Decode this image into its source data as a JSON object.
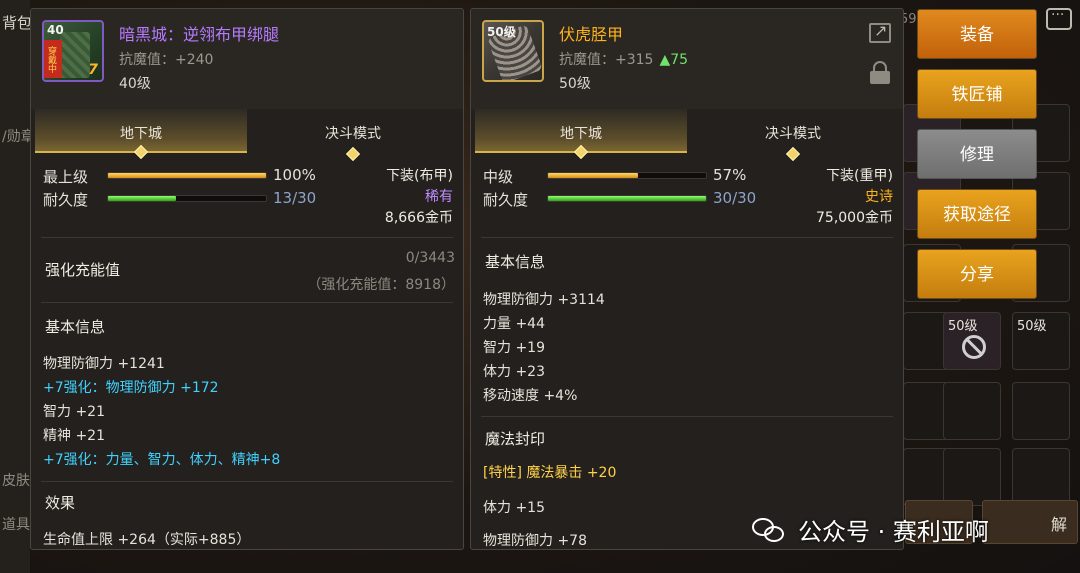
{
  "background": {
    "inventory_tab": "背包",
    "side_labels": [
      "/勋章",
      "皮肤",
      "道具"
    ],
    "top_stat": "59",
    "cells": [
      {
        "level": "50级",
        "banned": false
      },
      {
        "level": "50级",
        "banned": true
      },
      {
        "level": "50级",
        "banned": false
      }
    ],
    "bottom_btn_text": "解"
  },
  "item_left": {
    "name": "暗黑城：逆翎布甲绑腿",
    "resist_label": "抗魔值：",
    "resist_value": "+240",
    "level_req": "40级",
    "icon_level": "40",
    "icon_ribbon": "穿戴中",
    "icon_enhance": "7",
    "tabs": [
      "地下城",
      "决斗模式"
    ],
    "grade_label": "最上级",
    "grade_pct": "100%",
    "grade_fill": 1.0,
    "durability_label": "耐久度",
    "durability": "13/30",
    "durability_fill": 0.4333,
    "slot_type": "下装(布甲)",
    "rarity": "稀有",
    "price": "8,666金币",
    "charge_title": "强化充能值",
    "charge_value": "0/3443",
    "charge_sub": "（强化充能值：8918）",
    "basic_title": "基本信息",
    "basic_stats": [
      {
        "text": "物理防御力 +1241",
        "style": "white"
      },
      {
        "text": "+7强化：物理防御力 +172",
        "style": "cyan"
      },
      {
        "text": "智力 +21",
        "style": "white"
      },
      {
        "text": "精神 +21",
        "style": "white"
      },
      {
        "text": "+7强化：力量、智力、体力、精神+8",
        "style": "cyan"
      }
    ],
    "effect_title": "效果",
    "effect_line": "生命值上限 +264（实际+885）"
  },
  "item_right": {
    "name": "伏虎胫甲",
    "resist_label": "抗魔值：",
    "resist_value": "+315",
    "resist_up": "▲75",
    "level_req": "50级",
    "icon_level": "50级",
    "tabs": [
      "地下城",
      "决斗模式"
    ],
    "grade_label": "中级",
    "grade_pct": "57%",
    "grade_fill": 0.57,
    "durability_label": "耐久度",
    "durability": "30/30",
    "durability_fill": 1.0,
    "slot_type": "下装(重甲)",
    "rarity": "史诗",
    "price": "75,000金币",
    "basic_title": "基本信息",
    "basic_stats": [
      "物理防御力 +3114",
      "力量 +44",
      "智力 +19",
      "体力 +23",
      "移动速度 +4%"
    ],
    "seal_title": "魔法封印",
    "seal_stats": [
      {
        "text": "[特性] 魔法暴击 +20",
        "style": "yellow"
      },
      {
        "text": "体力 +15",
        "style": "white"
      },
      {
        "text": "物理防御力 +78",
        "style": "white"
      }
    ]
  },
  "side_buttons": [
    {
      "label": "装备",
      "style": "orange"
    },
    {
      "label": "铁匠铺",
      "style": "gold"
    },
    {
      "label": "修理",
      "style": "grey"
    },
    {
      "label": "获取途径",
      "style": "gold"
    },
    {
      "label": "分享",
      "style": "gold"
    }
  ],
  "watermark": "公众号 · 赛利亚啊"
}
